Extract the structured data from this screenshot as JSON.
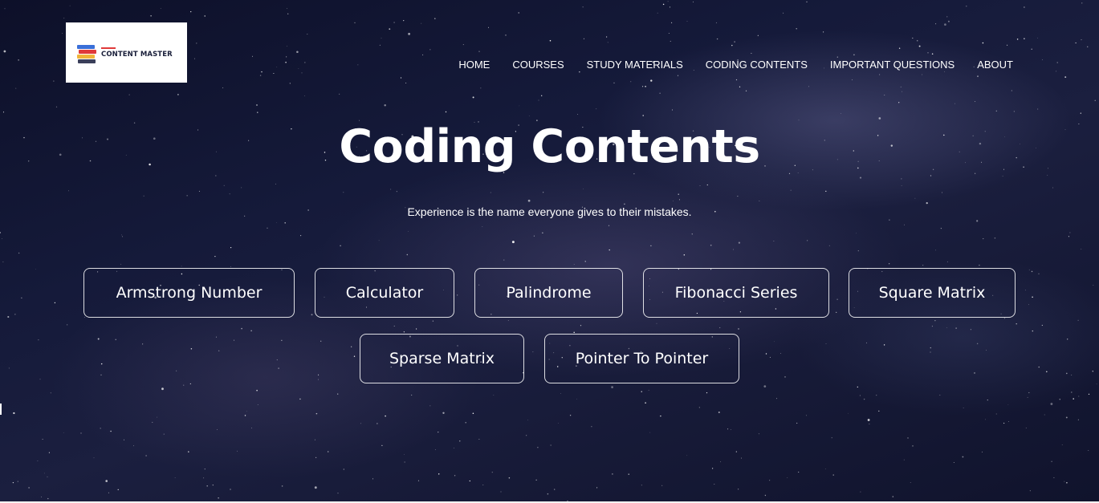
{
  "brand": {
    "name": "CONTENT MASTER",
    "colors": {
      "bar": "#e03a3a",
      "text": "#1a1f3a"
    }
  },
  "nav": {
    "items": [
      {
        "label": "HOME"
      },
      {
        "label": "COURSES"
      },
      {
        "label": "STUDY MATERIALS"
      },
      {
        "label": "CODING CONTENTS"
      },
      {
        "label": "IMPORTANT QUESTIONS"
      },
      {
        "label": "ABOUT"
      }
    ]
  },
  "hero": {
    "title": "Coding Contents",
    "subtitle": "Experience is the name everyone gives to their mistakes."
  },
  "topics": {
    "row1": [
      {
        "label": "Armstrong Number"
      },
      {
        "label": "Calculator"
      },
      {
        "label": "Palindrome"
      },
      {
        "label": "Fibonacci Series"
      },
      {
        "label": "Square Matrix"
      }
    ],
    "row2": [
      {
        "label": "Sparse Matrix"
      },
      {
        "label": "Pointer To Pointer"
      }
    ]
  },
  "theme": {
    "background": "#151a3a",
    "button_border": "#ffffff",
    "text": "#ffffff"
  }
}
